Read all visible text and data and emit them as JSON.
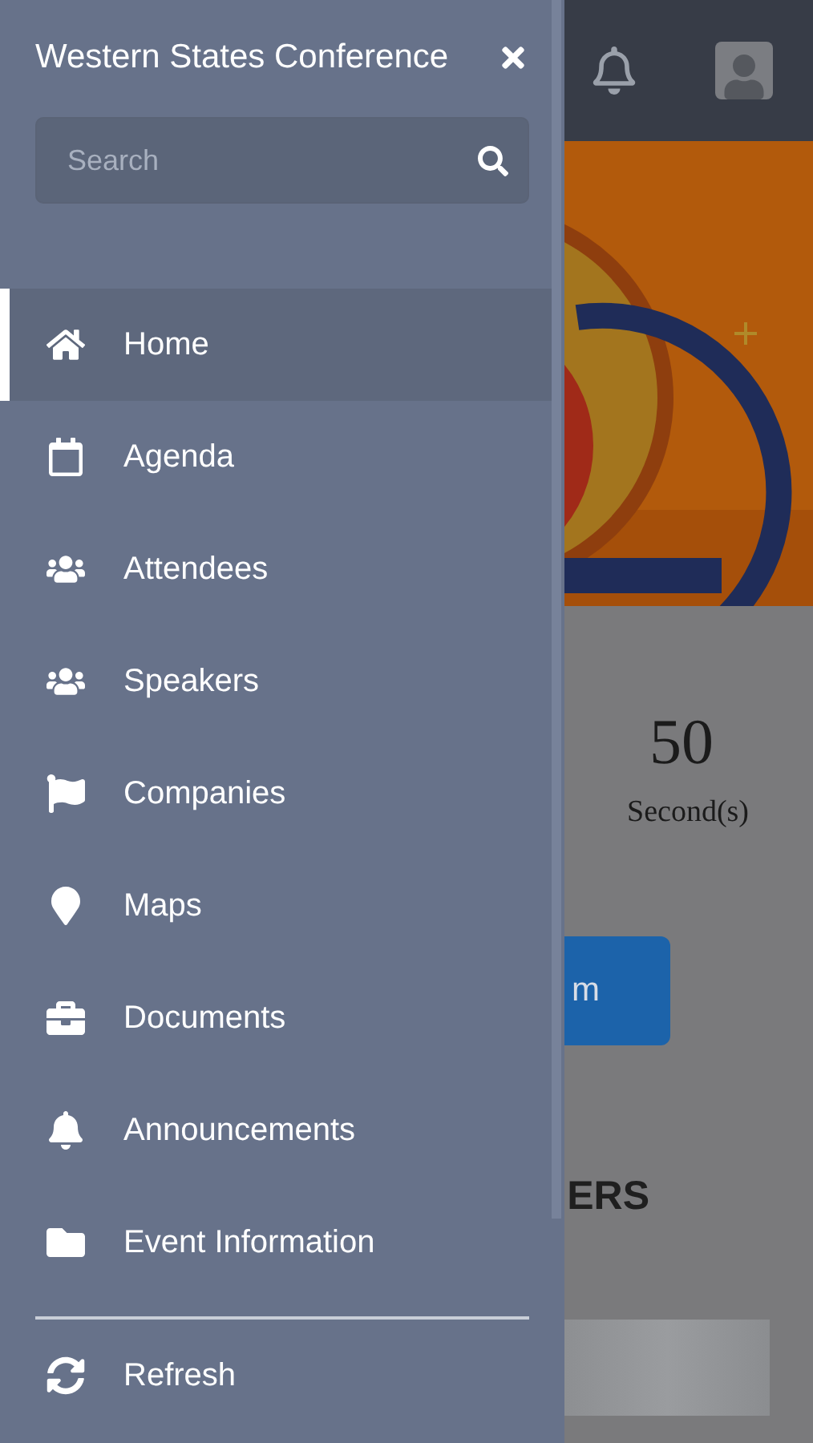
{
  "page": {
    "countdown": {
      "value": "50",
      "unit": "Second(s)"
    },
    "button": {
      "label": "m"
    },
    "section_heading": "ERS"
  },
  "drawer": {
    "title": "Western States Conference",
    "search": {
      "placeholder": "Search"
    },
    "items": [
      {
        "label": "Home",
        "kind": "home",
        "selected": true
      },
      {
        "label": "Agenda",
        "kind": "calendar",
        "selected": false
      },
      {
        "label": "Attendees",
        "kind": "users",
        "selected": false
      },
      {
        "label": "Speakers",
        "kind": "users",
        "selected": false
      },
      {
        "label": "Companies",
        "kind": "flag",
        "selected": false
      },
      {
        "label": "Maps",
        "kind": "marker",
        "selected": false
      },
      {
        "label": "Documents",
        "kind": "briefcase",
        "selected": false
      },
      {
        "label": "Announcements",
        "kind": "bell",
        "selected": false
      },
      {
        "label": "Event Information",
        "kind": "folder",
        "selected": false
      }
    ],
    "footer_items": [
      {
        "label": "Refresh",
        "kind": "refresh",
        "selected": false
      }
    ]
  }
}
